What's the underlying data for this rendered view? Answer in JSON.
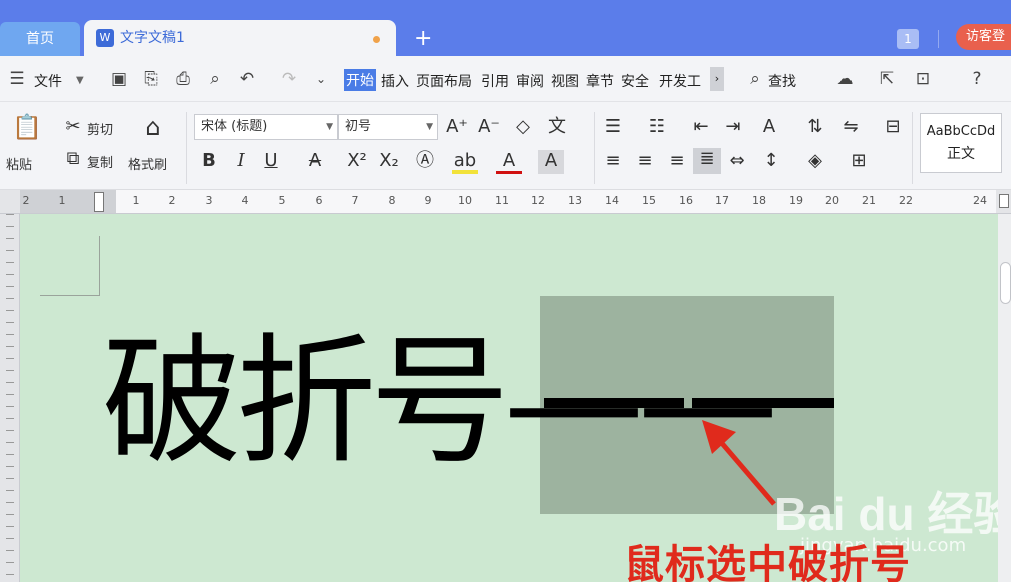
{
  "tabs": {
    "home": "首页",
    "doc_icon": "W",
    "doc_title": "文字文稿1",
    "new_tab": "+",
    "counter": "1",
    "guest": "访客登"
  },
  "menu": {
    "file": "文件",
    "items": [
      "开始",
      "插入",
      "页面布局",
      "引用",
      "审阅",
      "视图",
      "章节",
      "安全",
      "开发工"
    ],
    "search": "查找"
  },
  "ribbon": {
    "paste": "粘贴",
    "cut": "剪切",
    "copy": "复制",
    "format_painter": "格式刷",
    "font_name": "宋体 (标题)",
    "font_size": "初号",
    "bold": "B",
    "italic": "I",
    "underline": "U",
    "style_preview": "AaBbCcDd",
    "style_name": "正文"
  },
  "ruler": [
    "2",
    "1",
    "1",
    "2",
    "3",
    "4",
    "5",
    "6",
    "7",
    "8",
    "9",
    "10",
    "11",
    "12",
    "13",
    "14",
    "15",
    "16",
    "17",
    "18",
    "19",
    "20",
    "21",
    "22",
    "24"
  ],
  "document": {
    "body_text": "破折号——"
  },
  "annotation": {
    "caption": "鼠标选中破折号",
    "watermark": "Bai du 经验",
    "watermark_sub": "jingyan.baidu.com",
    "arrow_color": "#e02a1c"
  }
}
